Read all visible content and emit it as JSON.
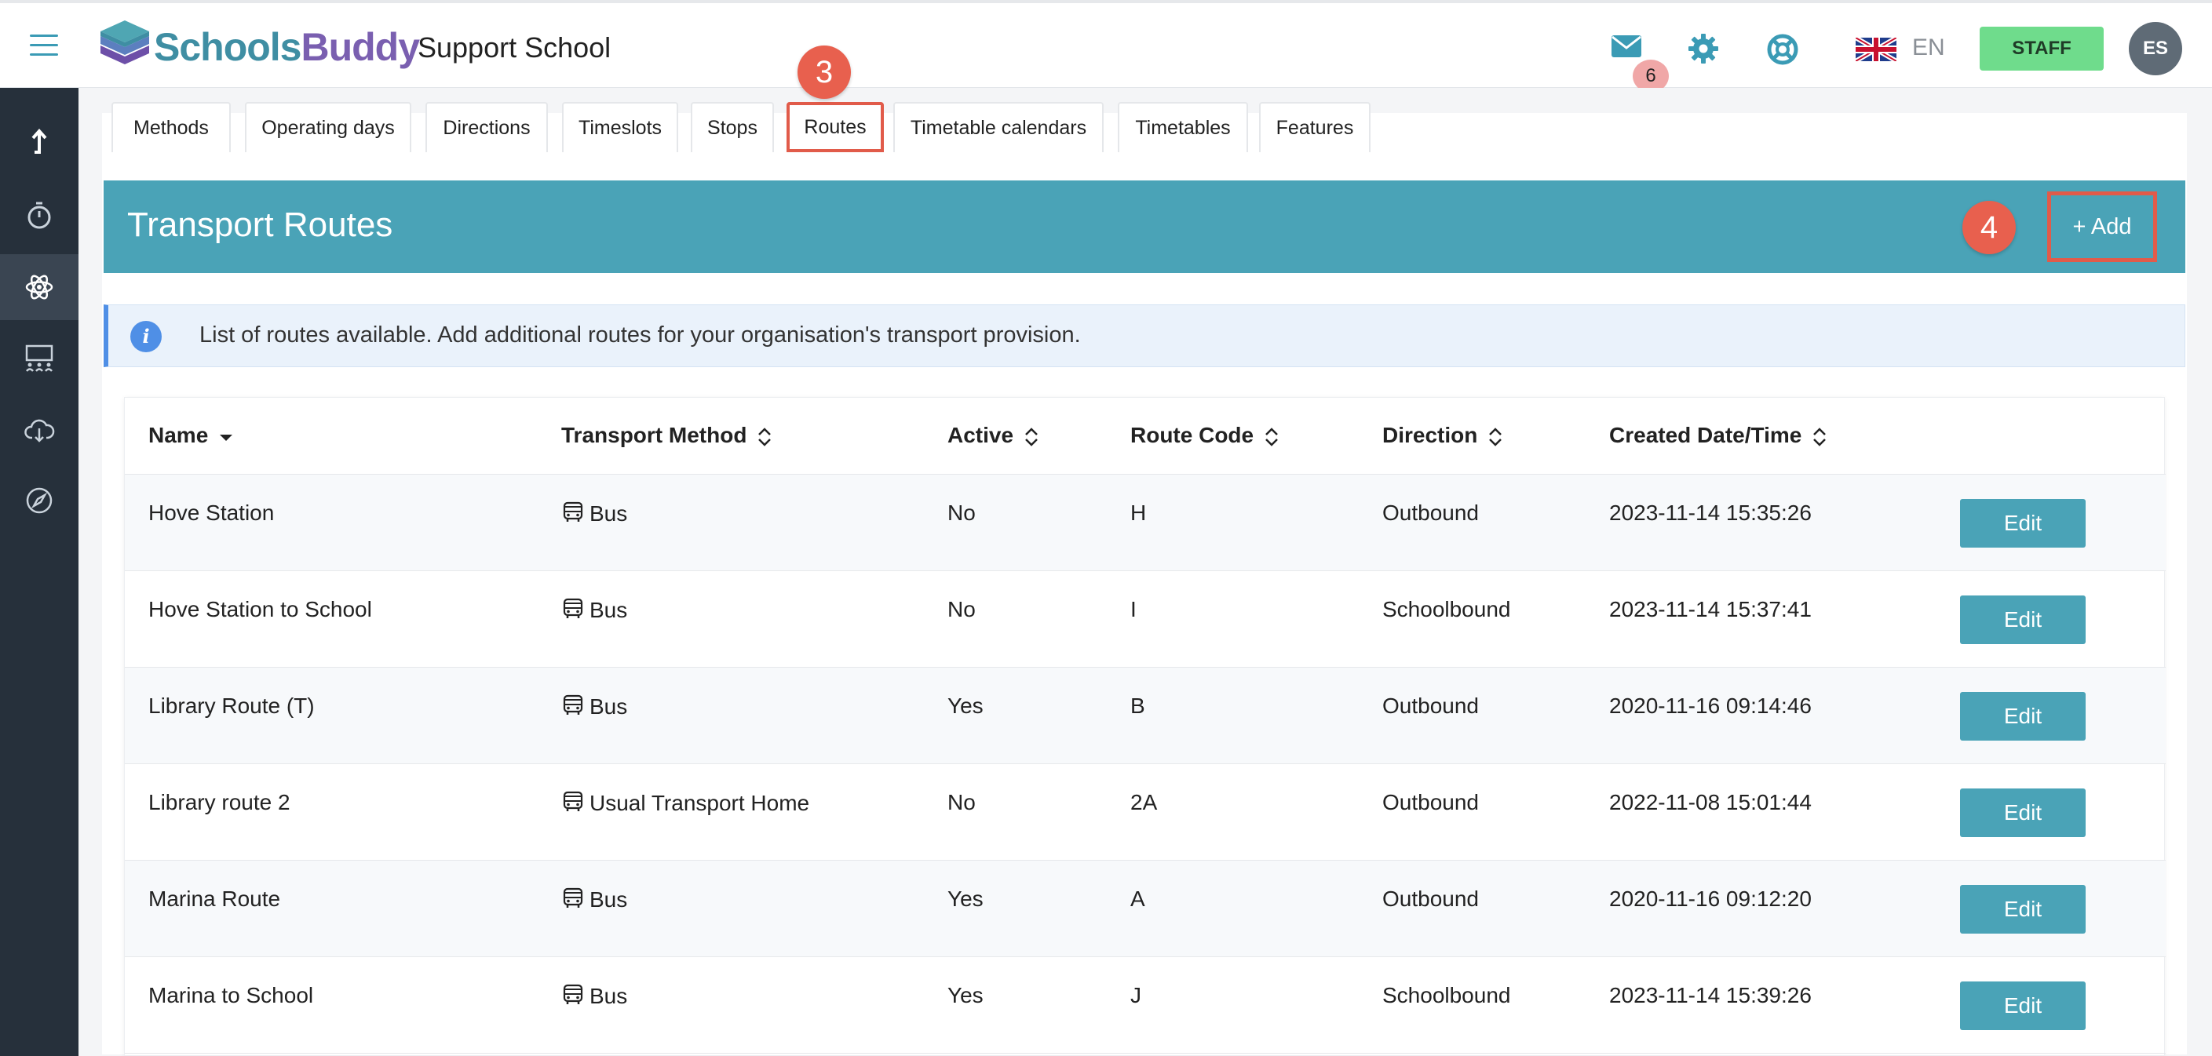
{
  "header": {
    "logo_text_1": "Schools",
    "logo_text_2": "Buddy",
    "school_name": "Support School",
    "mail_count": "6",
    "language": "EN",
    "staff_label": "STAFF",
    "avatar_initials": "ES"
  },
  "sidebar": {
    "items": [
      {
        "icon": "exit-arrow-icon"
      },
      {
        "icon": "stopwatch-icon"
      },
      {
        "icon": "atom-icon",
        "active": true
      },
      {
        "icon": "classroom-icon"
      },
      {
        "icon": "cloud-download-icon"
      },
      {
        "icon": "compass-icon"
      }
    ]
  },
  "tabs": [
    {
      "label": "Methods"
    },
    {
      "label": "Operating days"
    },
    {
      "label": "Directions"
    },
    {
      "label": "Timeslots"
    },
    {
      "label": "Stops"
    },
    {
      "label": "Routes",
      "active": true
    },
    {
      "label": "Timetable calendars"
    },
    {
      "label": "Timetables"
    },
    {
      "label": "Features"
    }
  ],
  "annotations": {
    "step_tab": "3",
    "step_add": "4"
  },
  "page": {
    "title": "Transport Routes",
    "add_label": "+ Add",
    "info_text": "List of routes available. Add additional routes for your organisation's transport provision."
  },
  "table": {
    "columns": [
      "Name",
      "Transport Method",
      "Active",
      "Route Code",
      "Direction",
      "Created Date/Time"
    ],
    "edit_label": "Edit",
    "rows": [
      {
        "name": "Hove Station",
        "method": "Bus",
        "active": "No",
        "code": "H",
        "direction": "Outbound",
        "created": "2023-11-14 15:35:26"
      },
      {
        "name": "Hove Station to School",
        "method": "Bus",
        "active": "No",
        "code": "I",
        "direction": "Schoolbound",
        "created": "2023-11-14 15:37:41"
      },
      {
        "name": "Library Route (T)",
        "method": "Bus",
        "active": "Yes",
        "code": "B",
        "direction": "Outbound",
        "created": "2020-11-16 09:14:46"
      },
      {
        "name": "Library route 2",
        "method": "Usual Transport Home",
        "active": "No",
        "code": "2A",
        "direction": "Outbound",
        "created": "2022-11-08 15:01:44"
      },
      {
        "name": "Marina Route",
        "method": "Bus",
        "active": "Yes",
        "code": "A",
        "direction": "Outbound",
        "created": "2020-11-16 09:12:20"
      },
      {
        "name": "Marina to School",
        "method": "Bus",
        "active": "Yes",
        "code": "J",
        "direction": "Schoolbound",
        "created": "2023-11-14 15:39:26"
      }
    ]
  },
  "colors": {
    "accent": "#4aa3b7",
    "sidebar": "#26303b",
    "staff": "#6fdc8c",
    "annotation": "#e8604e"
  }
}
